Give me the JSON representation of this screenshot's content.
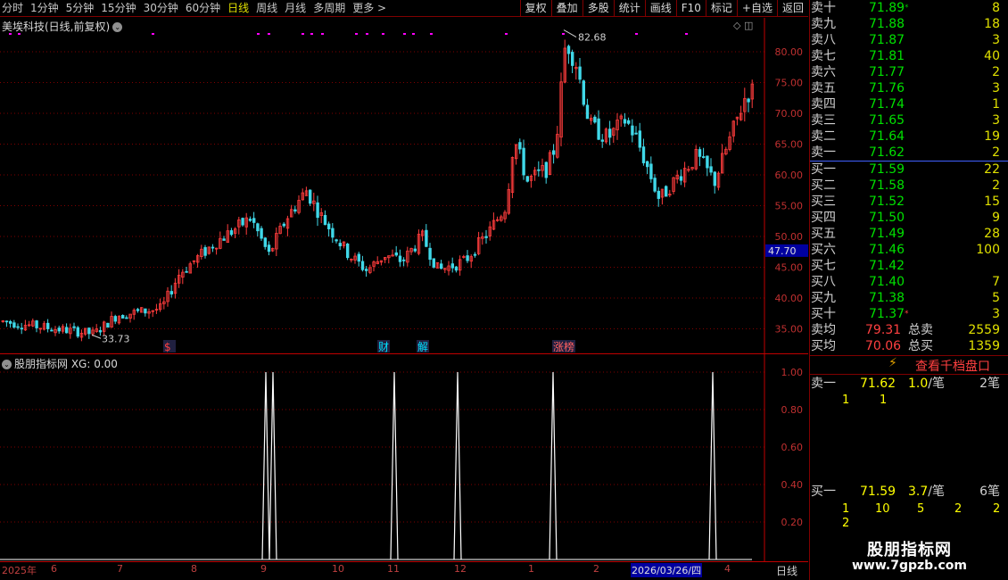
{
  "toolbar": {
    "periods": [
      "分时",
      "1分钟",
      "5分钟",
      "15分钟",
      "30分钟",
      "60分钟",
      "日线",
      "周线",
      "月线",
      "多周期",
      "更多 >"
    ],
    "active_period": "日线",
    "tools": [
      "复权",
      "叠加",
      "多股",
      "统计",
      "画线",
      "F10",
      "标记",
      "+自选",
      "返回"
    ]
  },
  "main_chart": {
    "title": "美埃科技(日线,前复权)",
    "title_arrow": "⌄",
    "controls": "◇ ◫",
    "y_ticks": [
      "80.00",
      "75.00",
      "70.00",
      "65.00",
      "60.00",
      "55.00",
      "50.00",
      "45.00",
      "40.00",
      "35.00"
    ],
    "cursor_price": "47.70",
    "high_label": "82.68",
    "low_label": "33.73",
    "event_markers": [
      {
        "label": "$",
        "color": "#ff4040"
      },
      {
        "label": "财",
        "color": "#00e0ff"
      },
      {
        "label": "解",
        "color": "#00e0ff"
      },
      {
        "label": "涨榜",
        "color": "#ff6060"
      }
    ]
  },
  "indicator": {
    "title": "股朋指标网 XG: 0.00",
    "title_arrow": "⌄",
    "y_ticks": [
      "1.00",
      "0.80",
      "0.60",
      "0.40",
      "0.20"
    ]
  },
  "date_axis": {
    "ticks": [
      "2025年",
      "6",
      "7",
      "8",
      "9",
      "10",
      "11",
      "12",
      "1",
      "2",
      "4"
    ],
    "cursor_date": "2026/03/26/四",
    "period_label": "日线"
  },
  "order_book": {
    "asks": [
      {
        "label": "卖十",
        "price": "71.89",
        "volume": "8",
        "mark": "*"
      },
      {
        "label": "卖九",
        "price": "71.88",
        "volume": "18",
        "mark": ""
      },
      {
        "label": "卖八",
        "price": "71.87",
        "volume": "3",
        "mark": ""
      },
      {
        "label": "卖七",
        "price": "71.81",
        "volume": "40",
        "mark": ""
      },
      {
        "label": "卖六",
        "price": "71.77",
        "volume": "2",
        "mark": ""
      },
      {
        "label": "卖五",
        "price": "71.76",
        "volume": "3",
        "mark": ""
      },
      {
        "label": "卖四",
        "price": "71.74",
        "volume": "1",
        "mark": ""
      },
      {
        "label": "卖三",
        "price": "71.65",
        "volume": "3",
        "mark": ""
      },
      {
        "label": "卖二",
        "price": "71.64",
        "volume": "19",
        "mark": ""
      },
      {
        "label": "卖一",
        "price": "71.62",
        "volume": "2",
        "mark": ""
      }
    ],
    "bids": [
      {
        "label": "买一",
        "price": "71.59",
        "volume": "22",
        "mark": ""
      },
      {
        "label": "买二",
        "price": "71.58",
        "volume": "2",
        "mark": ""
      },
      {
        "label": "买三",
        "price": "71.52",
        "volume": "15",
        "mark": ""
      },
      {
        "label": "买四",
        "price": "71.50",
        "volume": "9",
        "mark": ""
      },
      {
        "label": "买五",
        "price": "71.49",
        "volume": "28",
        "mark": ""
      },
      {
        "label": "买六",
        "price": "71.46",
        "volume": "100",
        "mark": ""
      },
      {
        "label": "买七",
        "price": "71.42",
        "volume": "",
        "mark": ""
      },
      {
        "label": "买八",
        "price": "71.40",
        "volume": "7",
        "mark": ""
      },
      {
        "label": "买九",
        "price": "71.38",
        "volume": "5",
        "mark": ""
      },
      {
        "label": "买十",
        "price": "71.37",
        "volume": "3",
        "mark": "*"
      }
    ],
    "ask_avg": {
      "label": "卖均",
      "price": "79.31",
      "total_label": "总卖",
      "total": "2559"
    },
    "bid_avg": {
      "label": "买均",
      "price": "70.06",
      "total_label": "总买",
      "total": "1359"
    },
    "deep_button": "查看千档盘口",
    "queue_ask": {
      "label": "卖一",
      "price": "71.62",
      "qty": "1.0",
      "slash": "/笔",
      "count": "2笔",
      "orders": [
        "1",
        "1"
      ]
    },
    "queue_bid": {
      "label": "买一",
      "price": "71.59",
      "qty": "3.7",
      "slash": "/笔",
      "count": "6笔",
      "orders": [
        "1",
        "10",
        "5",
        "2",
        "2",
        "2"
      ]
    }
  },
  "watermark": {
    "title": "股朋指标网",
    "url": "www.7gpzb.com"
  },
  "colors": {
    "up": "#ff3c3c",
    "down": "#40d8e8",
    "grid": "#800000",
    "bg": "#000000",
    "signal": "#ffffff",
    "magenta": "#ff00ff"
  }
}
